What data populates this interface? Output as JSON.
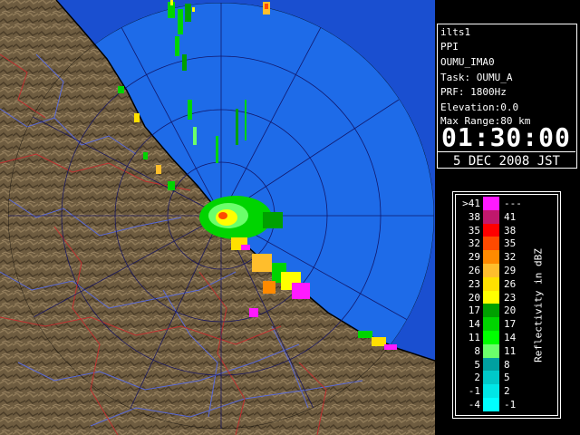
{
  "info": {
    "radar_name": "ilts1",
    "scan_type": "PPI",
    "site": "OUMU_IMA0",
    "task": "Task: OUMU_A",
    "prf": "PRF: 1800Hz",
    "elevation": "Elevation:0.0",
    "max_range": "Max Range:80 km",
    "time": "01:30:00",
    "date": "5 DEC 2008 JST"
  },
  "legend": {
    "unit_label": "Reflectivity in dBZ",
    "bins": [
      {
        "low": ">41",
        "high": "---",
        "color": "#ff1aff"
      },
      {
        "low": "38",
        "high": "41",
        "color": "#c0186c"
      },
      {
        "low": "35",
        "high": "38",
        "color": "#ff0000"
      },
      {
        "low": "32",
        "high": "35",
        "color": "#ff4a00"
      },
      {
        "low": "29",
        "high": "32",
        "color": "#ff8a00"
      },
      {
        "low": "26",
        "high": "29",
        "color": "#ffbe2c"
      },
      {
        "low": "23",
        "high": "26",
        "color": "#ffe000"
      },
      {
        "low": "20",
        "high": "23",
        "color": "#ffff00"
      },
      {
        "low": "17",
        "high": "20",
        "color": "#00a000"
      },
      {
        "low": "14",
        "high": "17",
        "color": "#00d400"
      },
      {
        "low": "11",
        "high": "14",
        "color": "#00ff00"
      },
      {
        "low": "8",
        "high": "11",
        "color": "#6aff6a"
      },
      {
        "low": "5",
        "high": "8",
        "color": "#00a0a0"
      },
      {
        "low": "2",
        "high": "5",
        "color": "#00c8c8"
      },
      {
        "low": "-1",
        "high": "2",
        "color": "#00e6e6"
      },
      {
        "low": "-4",
        "high": "-1",
        "color": "#00ffff"
      }
    ]
  },
  "colors": {
    "sea_in_range": "#1e6be8",
    "sea_out_range": "#1a4fd0",
    "land": "#6b5a3e",
    "river": "#5a6ad8",
    "boundary": "#c03030"
  }
}
